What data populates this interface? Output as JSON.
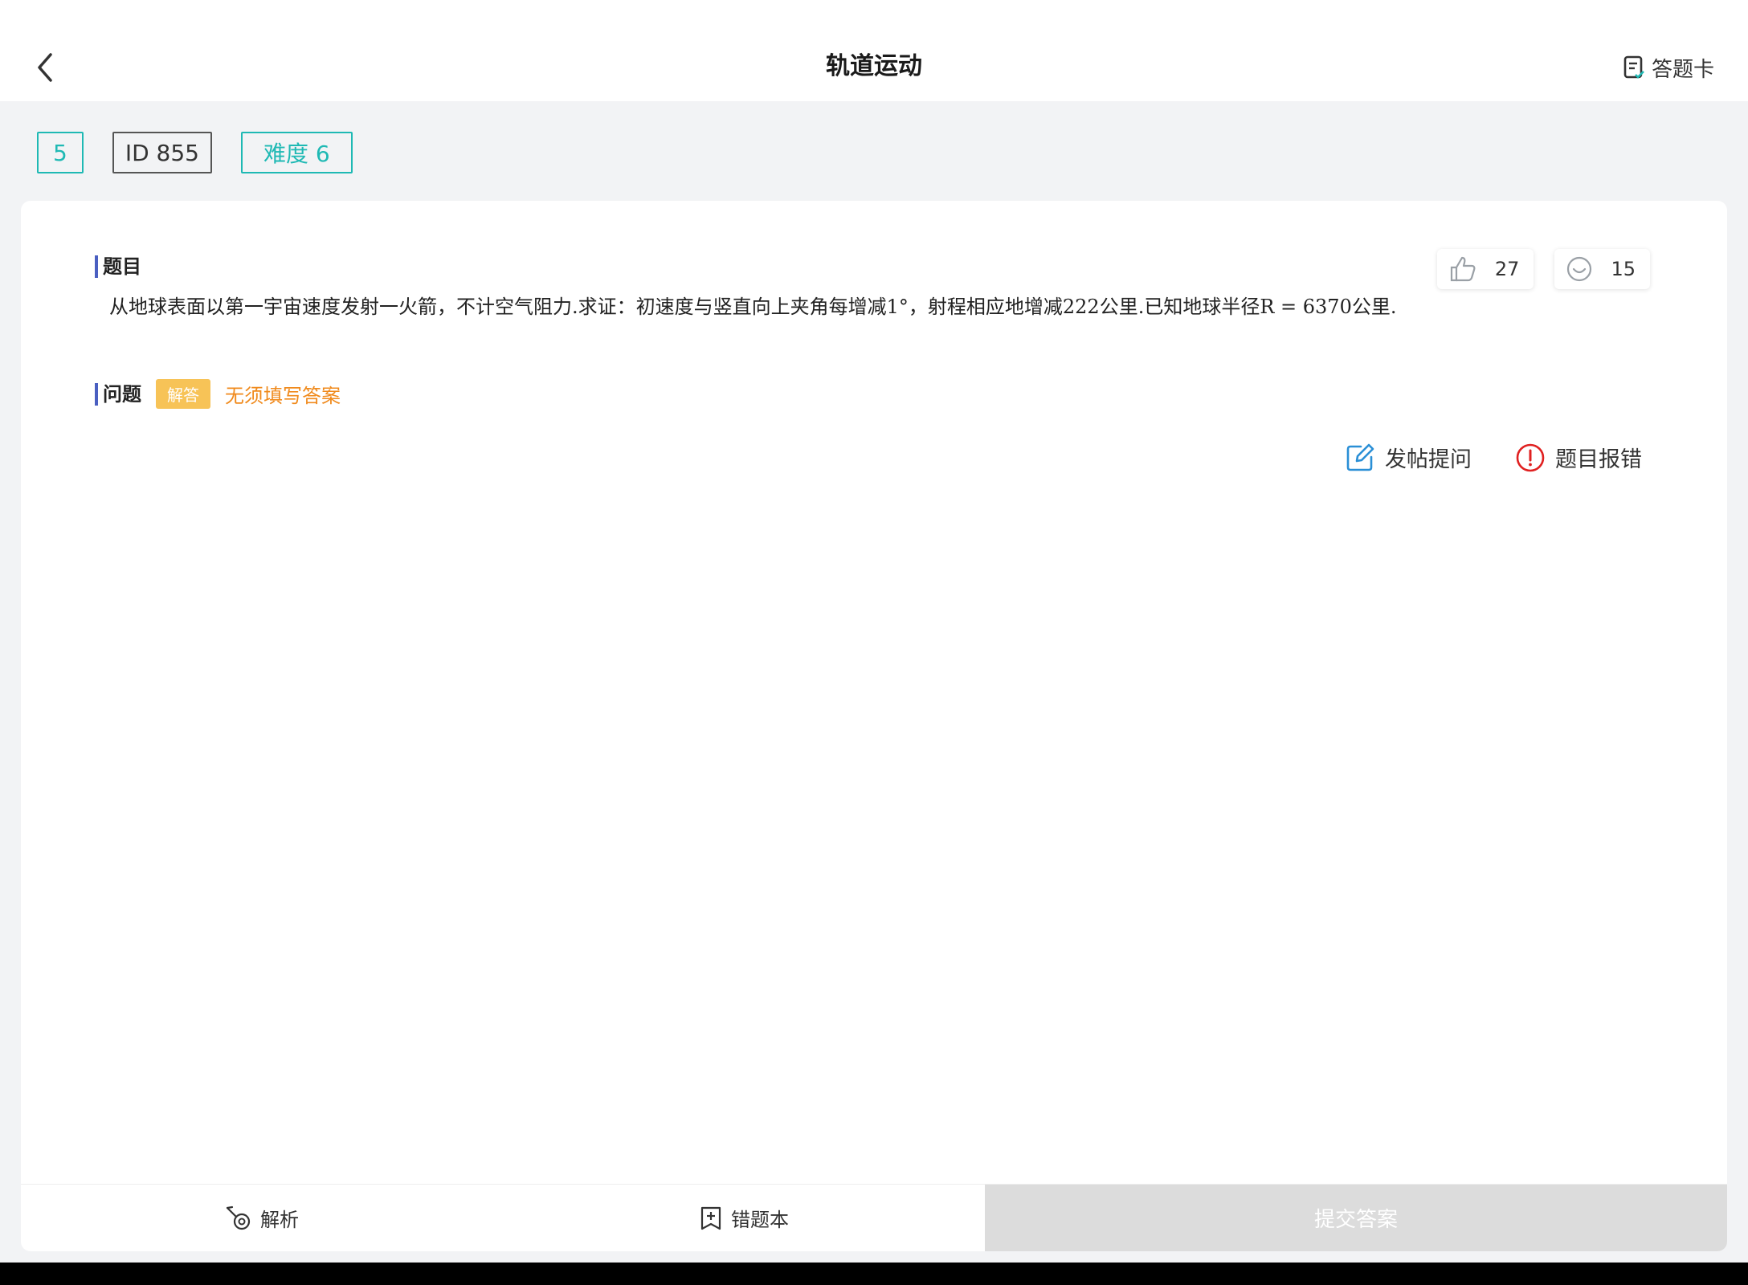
{
  "header": {
    "title": "轨道运动",
    "answer_card_label": "答题卡",
    "back_icon": "chevron-left-icon",
    "answer_card_icon": "answer-sheet-icon"
  },
  "tags": {
    "number": "5",
    "id": "ID 855",
    "difficulty": "难度 6"
  },
  "question": {
    "section_label": "题目",
    "stem": "从地球表面以第一宇宙速度发射一火箭，不计空气阻力.求证：初速度与竖直向上夹角每增减1°，射程相应地增减222公里.已知地球半径R = 6370公里."
  },
  "stats": {
    "likes": "27",
    "views": "15"
  },
  "problem": {
    "section_label": "问题",
    "type_badge": "解答",
    "note": "无须填写答案"
  },
  "actions": {
    "post_question": "发帖提问",
    "report_error": "题目报错"
  },
  "bottom": {
    "analysis": "解析",
    "wrong_book": "错题本",
    "submit": "提交答案"
  },
  "colors": {
    "accent": "#1fb9b4",
    "badge": "#f7c357",
    "note": "#f08a1c",
    "error": "#e02020",
    "edit": "#2a8fd6",
    "section_bar": "#4a5fc1"
  }
}
